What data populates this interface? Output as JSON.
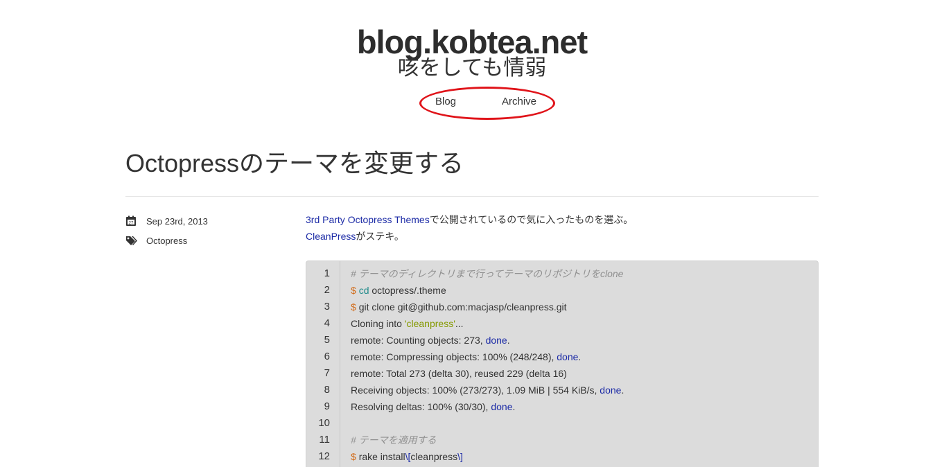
{
  "header": {
    "title": "blog.kobtea.net",
    "subtitle": "咳をしても情弱",
    "nav": [
      {
        "label": "Blog"
      },
      {
        "label": "Archive"
      }
    ],
    "highlight_color": "#e0141a"
  },
  "post": {
    "title": "Octopressのテーマを変更する",
    "date": "Sep 23rd, 2013",
    "tag": "Octopress",
    "paragraph1_link": "3rd Party Octopress Themes",
    "paragraph1_text": "で公開されているので気に入ったものを選ぶ。",
    "paragraph2_link": "CleanPress",
    "paragraph2_text": "がステキ。"
  },
  "code_block": {
    "line_numbers": [
      "1",
      "2",
      "3",
      "4",
      "5",
      "6",
      "7",
      "8",
      "9",
      "10",
      "11",
      "12"
    ],
    "lines": [
      [
        {
          "t": "# テーマのディレクトリまで行ってテーマのリポジトリをclone",
          "c": "cmt"
        }
      ],
      [
        {
          "t": "$ ",
          "c": "prompt"
        },
        {
          "t": "cd",
          "c": "kw"
        },
        {
          "t": " octopress/.theme",
          "c": ""
        }
      ],
      [
        {
          "t": "$ ",
          "c": "prompt"
        },
        {
          "t": "git clone git@github.com:macjasp/cleanpress.git",
          "c": ""
        }
      ],
      [
        {
          "t": "Cloning into ",
          "c": ""
        },
        {
          "t": "'cleanpress'",
          "c": "str"
        },
        {
          "t": "...",
          "c": ""
        }
      ],
      [
        {
          "t": "remote: Counting objects: 273, ",
          "c": ""
        },
        {
          "t": "done",
          "c": "done"
        },
        {
          "t": ".",
          "c": ""
        }
      ],
      [
        {
          "t": "remote: Compressing objects: 100% (248/248), ",
          "c": ""
        },
        {
          "t": "done",
          "c": "done"
        },
        {
          "t": ".",
          "c": ""
        }
      ],
      [
        {
          "t": "remote: Total 273 (delta 30), reused 229 (delta 16)",
          "c": ""
        }
      ],
      [
        {
          "t": "Receiving objects: 100% (273/273), 1.09 MiB | 554 KiB/s, ",
          "c": ""
        },
        {
          "t": "done",
          "c": "done"
        },
        {
          "t": ".",
          "c": ""
        }
      ],
      [
        {
          "t": "Resolving deltas: 100% (30/30), ",
          "c": ""
        },
        {
          "t": "done",
          "c": "done"
        },
        {
          "t": ".",
          "c": ""
        }
      ],
      [],
      [
        {
          "t": "# テーマを適用する",
          "c": "cmt"
        }
      ],
      [
        {
          "t": "$ ",
          "c": "prompt"
        },
        {
          "t": "rake install",
          "c": ""
        },
        {
          "t": "\\[",
          "c": "esc"
        },
        {
          "t": "cleanpress",
          "c": ""
        },
        {
          "t": "\\]",
          "c": "esc"
        }
      ]
    ]
  },
  "icons": {
    "date": "calendar-icon",
    "tags": "tags-icon"
  }
}
